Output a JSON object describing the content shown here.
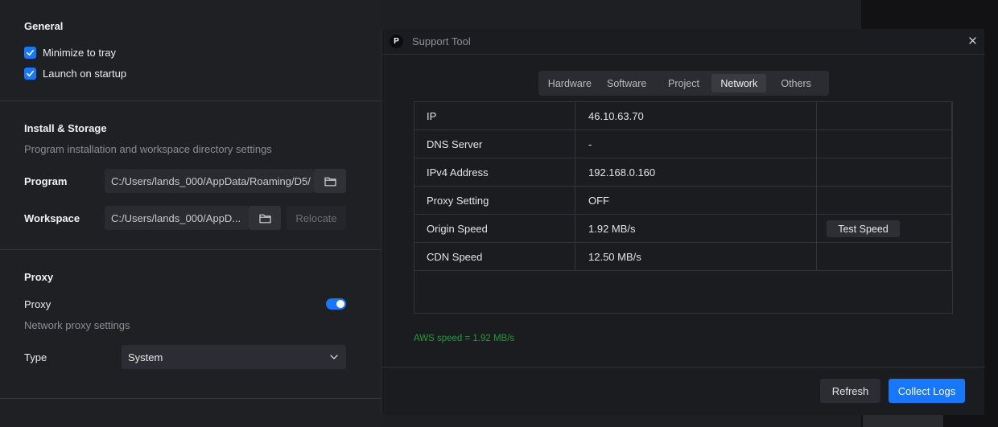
{
  "settings": {
    "general": {
      "title": "General",
      "minimize_to_tray": "Minimize to tray",
      "launch_on_startup": "Launch on startup"
    },
    "install": {
      "title": "Install & Storage",
      "description": "Program installation and workspace directory settings",
      "program_label": "Program",
      "program_path": "C:/Users/lands_000/AppData/Roaming/D5/",
      "workspace_label": "Workspace",
      "workspace_path": "C:/Users/lands_000/AppD...",
      "relocate_label": "Relocate"
    },
    "proxy": {
      "title": "Proxy",
      "proxy_label": "Proxy",
      "proxy_enabled": true,
      "description": "Network proxy settings",
      "type_label": "Type",
      "type_value": "System"
    }
  },
  "dialog": {
    "title": "Support Tool",
    "logo_letter": "P",
    "tabs": [
      "Hardware",
      "Software",
      "Project",
      "Network",
      "Others"
    ],
    "active_tab": "Network",
    "rows": [
      {
        "label": "IP",
        "value": "46.10.63.70"
      },
      {
        "label": "DNS Server",
        "value": "-"
      },
      {
        "label": "IPv4 Address",
        "value": "192.168.0.160"
      },
      {
        "label": "Proxy Setting",
        "value": "OFF"
      },
      {
        "label": "Origin Speed",
        "value": "1.92 MB/s"
      },
      {
        "label": "CDN Speed",
        "value": "12.50 MB/s"
      }
    ],
    "test_speed_label": "Test Speed",
    "aws_status": "AWS speed = 1.92 MB/s",
    "refresh_label": "Refresh",
    "collect_logs_label": "Collect Logs"
  },
  "colors": {
    "accent": "#1677ff",
    "success": "#239b3a",
    "background": "#1e1f23"
  }
}
